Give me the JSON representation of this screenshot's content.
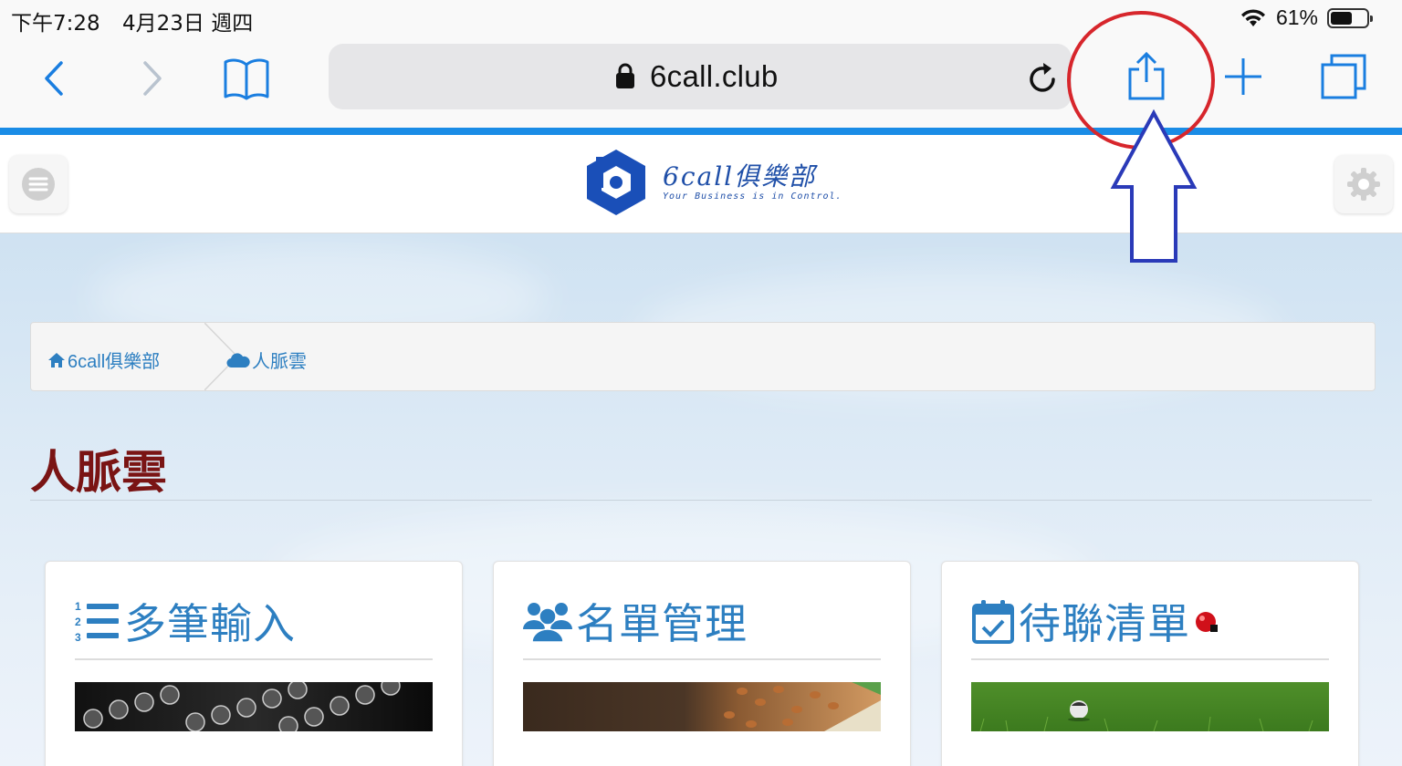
{
  "status": {
    "time": "下午7:28",
    "date": "4月23日 週四",
    "battery_percent": "61%",
    "battery_level": 0.61
  },
  "browser": {
    "url": "6call.club",
    "accent_color": "#1a8ce6"
  },
  "header": {
    "logo_title": "6call俱樂部",
    "logo_subtitle": "Your Business is in Control."
  },
  "breadcrumb": {
    "items": [
      {
        "label": "6call俱樂部",
        "icon": "home-icon"
      },
      {
        "label": "人脈雲",
        "icon": "cloud-icon"
      }
    ]
  },
  "main": {
    "title": "人脈雲",
    "cards": [
      {
        "title": "多筆輸入",
        "icon": "numbered-list-icon",
        "image": "typewriter keys"
      },
      {
        "title": "名單管理",
        "icon": "users-icon",
        "image": "soil and seeds"
      },
      {
        "title": "待聯清單",
        "icon": "calendar-check-icon",
        "image": "green grass field",
        "badge_color": "#d0101a"
      }
    ]
  },
  "colors": {
    "link_blue": "#2d7fc1",
    "title_red": "#7a1414",
    "annotation_red": "#d7262c",
    "annotation_arrow": "#2a3ab8"
  }
}
